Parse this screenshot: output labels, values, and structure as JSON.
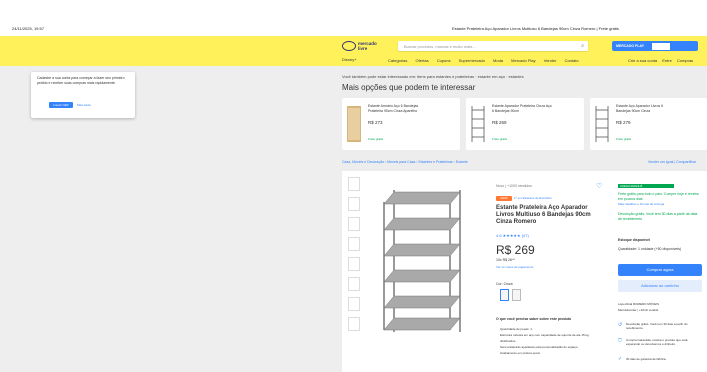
{
  "print_header": {
    "timestamp": "24/11/2025, 19:57",
    "page_title": "Estante Prateleira Aço Aparador Livros Multiuso 6 Bandejas 90cm Cinza Romero | Frete grátis"
  },
  "header": {
    "logo_line1": "mercado",
    "logo_line2": "livre",
    "disney_label": "Disney+",
    "search_placeholder": "Buscar produtos, marcas e muito mais...",
    "promo_label": "MERCADO PLAY",
    "nav_left": [
      "Categorias",
      "Ofertas",
      "Cupons",
      "Supermercado",
      "Moda",
      "Mercado Play",
      "Vender",
      "Contato"
    ],
    "nav_right": [
      "Crie a sua conta",
      "Entre",
      "Compras"
    ]
  },
  "popup": {
    "text": "Cadastre a sua conta para começar a fazer seu primeiro pedido e receber suas compras mais rapidamente.",
    "cep_button": "Inserir CEP",
    "later_button": "Mais tarde"
  },
  "recommendations": {
    "heading": "Você também pode estar interessado em: itens para estantes e prateleiras · estante em aço · estantes",
    "title": "Mais opções que podem te interessar",
    "cards": [
      {
        "title": "Estante Armário Aço 6 Bandejas Prateleira 90cm Cinza Aparelho",
        "price": "R$ 273",
        "ship": "Frete grátis"
      },
      {
        "title": "Estante Aparador Prateleira Cinza Aço 6 Bandejas 90cm",
        "price": "R$ 269",
        "ship": "Frete grátis"
      },
      {
        "title": "Estante Aço Aparador Livros 6 Bandejas 90cm Cinza",
        "price": "R$ 279",
        "ship": "Frete grátis"
      }
    ]
  },
  "breadcrumb": {
    "path": "Casa, Móveis e Decoração  ›  Móveis para Casa  ›  Estantes e Prateleiras  ›  Estante",
    "right": "Vender um igual  |  Compartilhar"
  },
  "product": {
    "condition": "Novo  |  +1000 vendidos",
    "badge": "MAIS VENDIDO",
    "badge_extra": "1º em Estantes de Escritório",
    "title": "Estante Prateleira Aço Aparador Livros Multiuso 6 Bandejas 90cm Cinza Romero",
    "rating": "4.6 ★★★★★ (47)",
    "price": "R$ 269",
    "installments": "10x R$ 26⁹⁰",
    "payment_link": "Ver os meios de pagamento",
    "color_label": "Cor: Cinza",
    "need_title": "O que você precisa saber sobre este produto",
    "bullets": [
      "Quantidade de peças: 1.",
      "Estrutura robusta em aço com capacidade de suporte de até 15 kg distribuídos.",
      "Seis prateleiras ajustáveis para personalização do espaço.",
      "Acabamento em pintura epóxi."
    ]
  },
  "buybox": {
    "badge": "CHEGA AMANHÃ",
    "shipping_free": "Frete grátis para todo o país. Compre hoje e receba em poucos dias",
    "shipping_link": "Mais detalhes e formas de entrega",
    "return": "Devolução grátis. Você tem 30 dias a partir da data de recebimento",
    "stock": "Estoque disponível",
    "quantity": "Quantidade: 1 unidade  (+50 disponíveis)",
    "buy_now": "Comprar agora",
    "add_cart": "Adicionar ao carrinho",
    "seller": "Loja oficial ROMERO MÓVEIS",
    "seller_level": "MercadoLíder | +10mil vendas",
    "benefits": [
      "Devolução grátis. Você tem 30 dias a partir do recebimento.",
      "Compra Garantida, receba o produto que está esperando ou devolvemos o dinheiro.",
      "30 dias de garantia de fábrica."
    ]
  }
}
